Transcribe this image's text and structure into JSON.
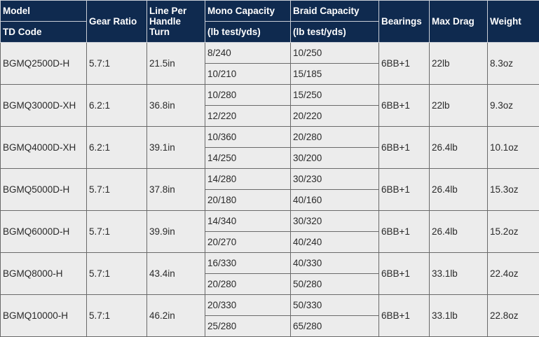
{
  "headers": {
    "model": "Model",
    "td_code": "TD Code",
    "gear_ratio": "Gear Ratio",
    "line_per_handle_turn": "Line Per Handle Turn",
    "mono_capacity": "Mono Capacity",
    "mono_units": "(lb test/yds)",
    "braid_capacity": "Braid Capacity",
    "braid_units": "(lb test/yds)",
    "bearings": "Bearings",
    "max_drag": "Max Drag",
    "weight": "Weight"
  },
  "rows": [
    {
      "code": "BGMQ2500D-H",
      "gear_ratio": "5.7:1",
      "line": "21.5in",
      "mono": [
        "8/240",
        "10/210"
      ],
      "braid": [
        "10/250",
        "15/185"
      ],
      "bearings": "6BB+1",
      "drag": "22lb",
      "weight": "8.3oz"
    },
    {
      "code": "BGMQ3000D-XH",
      "gear_ratio": "6.2:1",
      "line": "36.8in",
      "mono": [
        "10/280",
        "12/220"
      ],
      "braid": [
        "15/250",
        "20/220"
      ],
      "bearings": "6BB+1",
      "drag": "22lb",
      "weight": "9.3oz"
    },
    {
      "code": "BGMQ4000D-XH",
      "gear_ratio": "6.2:1",
      "line": "39.1in",
      "mono": [
        "10/360",
        "14/250"
      ],
      "braid": [
        "20/280",
        "30/200"
      ],
      "bearings": "6BB+1",
      "drag": "26.4lb",
      "weight": "10.1oz"
    },
    {
      "code": "BGMQ5000D-H",
      "gear_ratio": "5.7:1",
      "line": "37.8in",
      "mono": [
        "14/280",
        "20/180"
      ],
      "braid": [
        "30/230",
        "40/160"
      ],
      "bearings": "6BB+1",
      "drag": "26.4lb",
      "weight": "15.3oz"
    },
    {
      "code": "BGMQ6000D-H",
      "gear_ratio": "5.7:1",
      "line": "39.9in",
      "mono": [
        "14/340",
        "20/270"
      ],
      "braid": [
        "30/320",
        "40/240"
      ],
      "bearings": "6BB+1",
      "drag": "26.4lb",
      "weight": "15.2oz"
    },
    {
      "code": "BGMQ8000-H",
      "gear_ratio": "5.7:1",
      "line": "43.4in",
      "mono": [
        "16/330",
        "20/280"
      ],
      "braid": [
        "40/330",
        "50/280"
      ],
      "bearings": "6BB+1",
      "drag": "33.1lb",
      "weight": "22.4oz"
    },
    {
      "code": "BGMQ10000-H",
      "gear_ratio": "5.7:1",
      "line": "46.2in",
      "mono": [
        "20/330",
        "25/280"
      ],
      "braid": [
        "50/330",
        "65/280"
      ],
      "bearings": "6BB+1",
      "drag": "33.1lb",
      "weight": "22.8oz"
    }
  ]
}
